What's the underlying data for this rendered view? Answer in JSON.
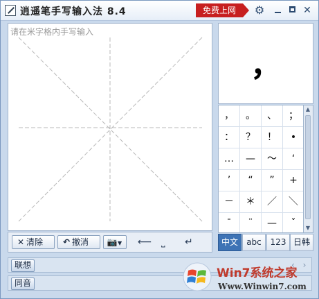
{
  "titlebar": {
    "title": "逍遥笔手写输入法 8.4",
    "ad_button": "免费上网"
  },
  "pad": {
    "hint": "请在米字格内手写输入"
  },
  "toolbar": {
    "clear_label": "清除",
    "undo_label": "撤消"
  },
  "candidate": {
    "main": "，"
  },
  "symbols": [
    "，",
    "。",
    "、",
    "；",
    "：",
    "？",
    "！",
    "•",
    "…",
    "—",
    "～",
    "‘",
    "’",
    "“",
    "”",
    "+",
    "－",
    "＊",
    "／",
    "＼",
    "ˉ",
    "¨",
    "—",
    "ˇ"
  ],
  "tabs": [
    {
      "label": "中文",
      "active": true
    },
    {
      "label": "abc",
      "active": false
    },
    {
      "label": "123",
      "active": false
    },
    {
      "label": "日韩",
      "active": false
    }
  ],
  "bottom": {
    "assoc_label": "联想",
    "homophone_label": "同音"
  },
  "watermark": {
    "brand": "Win7系统之家",
    "site": "Www.Winwin7.com"
  },
  "colors": {
    "ad": "#c71f1f",
    "active_tab": "#3e73b5"
  }
}
